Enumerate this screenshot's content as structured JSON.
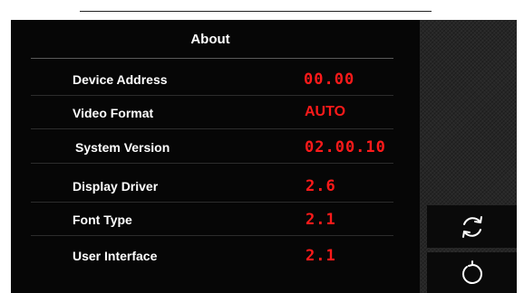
{
  "screen": {
    "title": "About",
    "rows": [
      {
        "label": "Device Address",
        "value": "00.00"
      },
      {
        "label": "Video Format",
        "value": "AUTO"
      },
      {
        "label": "System Version",
        "value": "02.00.10"
      },
      {
        "label": "Display Driver",
        "value": "2.6"
      },
      {
        "label": "Font Type",
        "value": "2.1"
      },
      {
        "label": "User Interface",
        "value": "2.1"
      }
    ]
  },
  "side_buttons": [
    {
      "icon": "refresh-icon"
    },
    {
      "icon": "restore-icon"
    }
  ],
  "colors": {
    "background": "#060606",
    "label": "#ffffff",
    "value": "#ff1a1a",
    "sidebar": "#262626"
  }
}
